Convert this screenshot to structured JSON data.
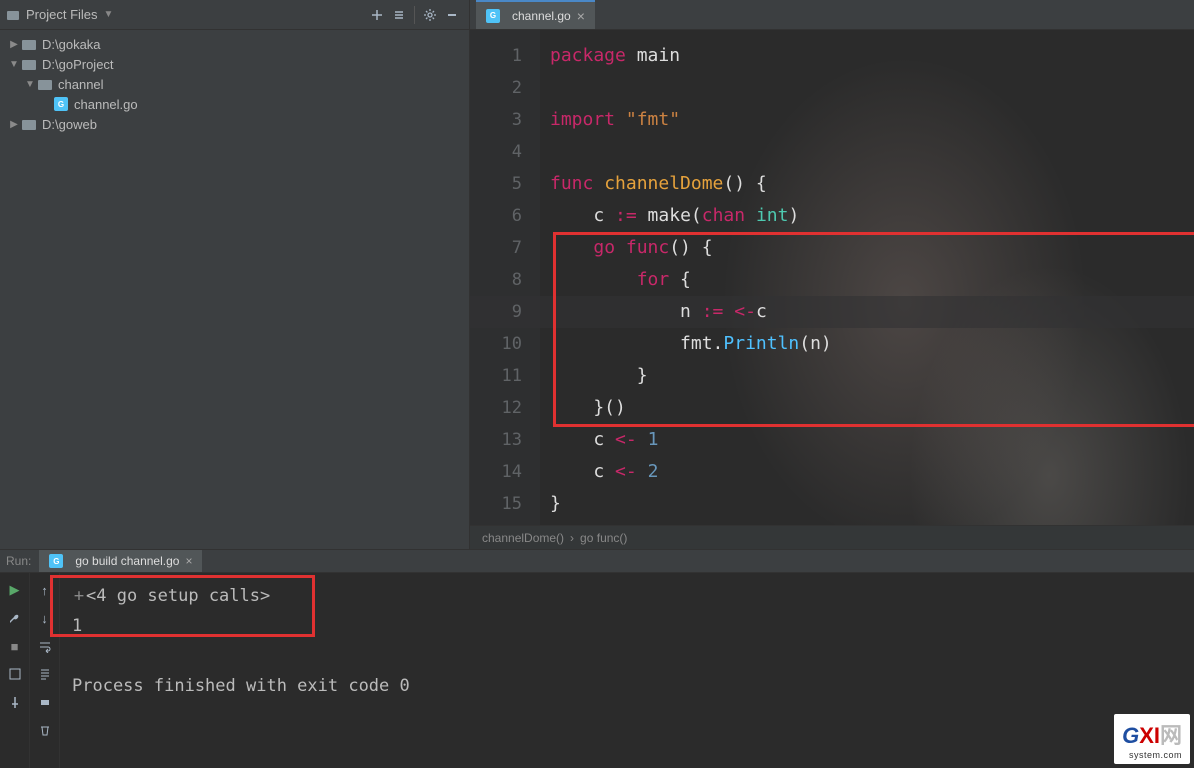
{
  "sidebar": {
    "header": "Project Files",
    "tree": [
      {
        "label": "D:\\gokaka",
        "type": "dir",
        "expand": "▶",
        "indent": 0
      },
      {
        "label": "D:\\goProject",
        "type": "dir",
        "expand": "▼",
        "indent": 0
      },
      {
        "label": "channel",
        "type": "dir",
        "expand": "▼",
        "indent": 1
      },
      {
        "label": "channel.go",
        "type": "gofile",
        "expand": "",
        "indent": 2
      },
      {
        "label": "D:\\goweb",
        "type": "dir",
        "expand": "▶",
        "indent": 0
      }
    ]
  },
  "tab": {
    "label": "channel.go",
    "close": "×"
  },
  "code": {
    "lines": [
      {
        "n": "1",
        "tokens": [
          [
            "kw",
            "package "
          ],
          [
            "id",
            "main"
          ]
        ]
      },
      {
        "n": "2",
        "tokens": []
      },
      {
        "n": "3",
        "tokens": [
          [
            "kw",
            "import "
          ],
          [
            "str",
            "\"fmt\""
          ]
        ]
      },
      {
        "n": "4",
        "tokens": []
      },
      {
        "n": "5",
        "tokens": [
          [
            "kw",
            "func "
          ],
          [
            "funcname",
            "channelDome"
          ],
          [
            "op",
            "() {"
          ]
        ]
      },
      {
        "n": "6",
        "tokens": [
          [
            "id",
            "    c "
          ],
          [
            "kw",
            ":="
          ],
          [
            "id",
            " make("
          ],
          [
            "kw",
            "chan "
          ],
          [
            "type",
            "int"
          ],
          [
            "op",
            ")"
          ]
        ]
      },
      {
        "n": "7",
        "tokens": [
          [
            "id",
            "    "
          ],
          [
            "kw",
            "go func"
          ],
          [
            "op",
            "() {"
          ]
        ]
      },
      {
        "n": "8",
        "tokens": [
          [
            "id",
            "        "
          ],
          [
            "kw",
            "for"
          ],
          [
            "op",
            " {"
          ]
        ]
      },
      {
        "n": "9",
        "tokens": [
          [
            "id",
            "            n "
          ],
          [
            "kw",
            ":="
          ],
          [
            "id",
            " "
          ],
          [
            "kw",
            "<-"
          ],
          [
            "id",
            "c"
          ]
        ]
      },
      {
        "n": "10",
        "tokens": [
          [
            "id",
            "            fmt."
          ],
          [
            "fn",
            "Println"
          ],
          [
            "op",
            "(n)"
          ]
        ]
      },
      {
        "n": "11",
        "tokens": [
          [
            "op",
            "        }"
          ]
        ]
      },
      {
        "n": "12",
        "tokens": [
          [
            "op",
            "    }()"
          ]
        ]
      },
      {
        "n": "13",
        "tokens": [
          [
            "id",
            "    c "
          ],
          [
            "kw",
            "<-"
          ],
          [
            "id",
            " "
          ],
          [
            "num",
            "1"
          ]
        ]
      },
      {
        "n": "14",
        "tokens": [
          [
            "id",
            "    c "
          ],
          [
            "kw",
            "<-"
          ],
          [
            "id",
            " "
          ],
          [
            "num",
            "2"
          ]
        ]
      },
      {
        "n": "15",
        "tokens": [
          [
            "op",
            "}"
          ]
        ]
      }
    ],
    "highlight_line_index": 8
  },
  "breadcrumb": {
    "items": [
      "channelDome()",
      "go func()"
    ],
    "sep": "›"
  },
  "run": {
    "label": "Run:",
    "config": "go build channel.go",
    "close": "×",
    "console_lines": [
      "<4 go setup calls>",
      "1",
      "",
      "Process finished with exit code 0"
    ]
  },
  "watermark": {
    "g": "G",
    "xi": "XI",
    "rest": "网",
    "sub": "system.com"
  }
}
